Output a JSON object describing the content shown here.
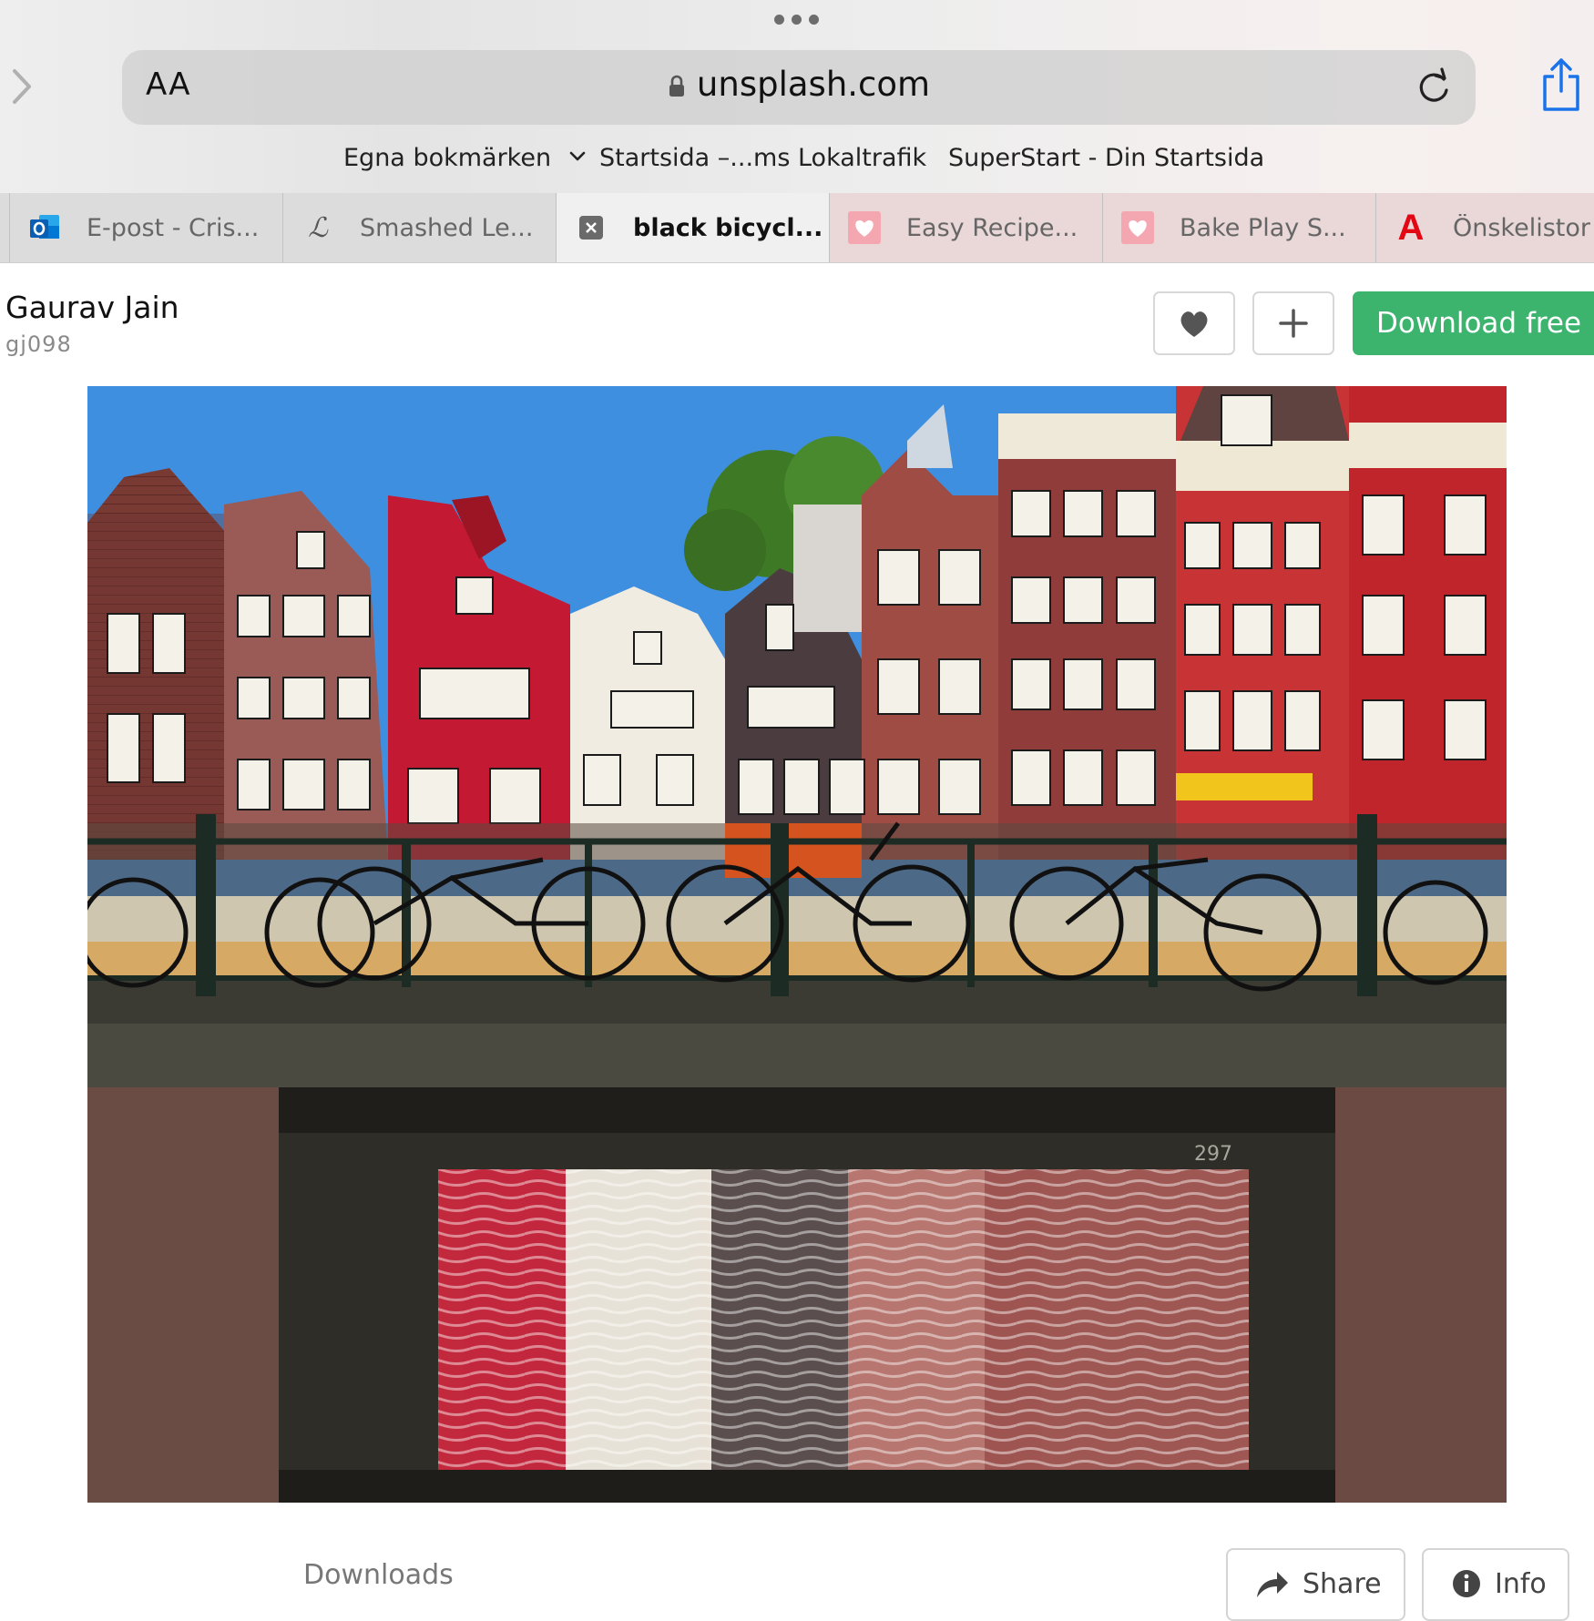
{
  "browser": {
    "address_bar": {
      "text_size_label": "AA",
      "url": "unsplash.com"
    },
    "bookmarks": [
      {
        "label": "Egna bokmärken"
      },
      {
        "label": "Startsida –...ms Lokaltrafik"
      },
      {
        "label": "SuperStart - Din Startsida"
      }
    ],
    "tabs": [
      {
        "label": "E-post - Cris...",
        "icon": "outlook-icon"
      },
      {
        "label": "Smashed Le...",
        "icon": "script-logo-icon"
      },
      {
        "label": "black bicycl...",
        "icon": "close-tab-icon",
        "active": true
      },
      {
        "label": "Easy Recipe...",
        "icon": "heart-favicon-icon"
      },
      {
        "label": "Bake Play S...",
        "icon": "heart-favicon-icon"
      },
      {
        "label": "Önskelistor |...",
        "icon": "letter-a-logo-icon"
      }
    ]
  },
  "photo_page": {
    "author": {
      "name": "Gaurav Jain",
      "username": "gj098"
    },
    "actions": {
      "like_icon": "heart-icon",
      "add_icon": "plus-icon",
      "download_label": "Download free"
    },
    "photo": {
      "subject": "Amsterdam canal houses with black bicycles on bridge",
      "bridge_number": "297"
    },
    "footer": {
      "downloads_label": "Downloads",
      "share_label": "Share",
      "info_label": "Info"
    }
  },
  "colors": {
    "download_button": "#3cb46e",
    "tab_active": "#f0f0f0",
    "accent_blue": "#1a73e8"
  }
}
